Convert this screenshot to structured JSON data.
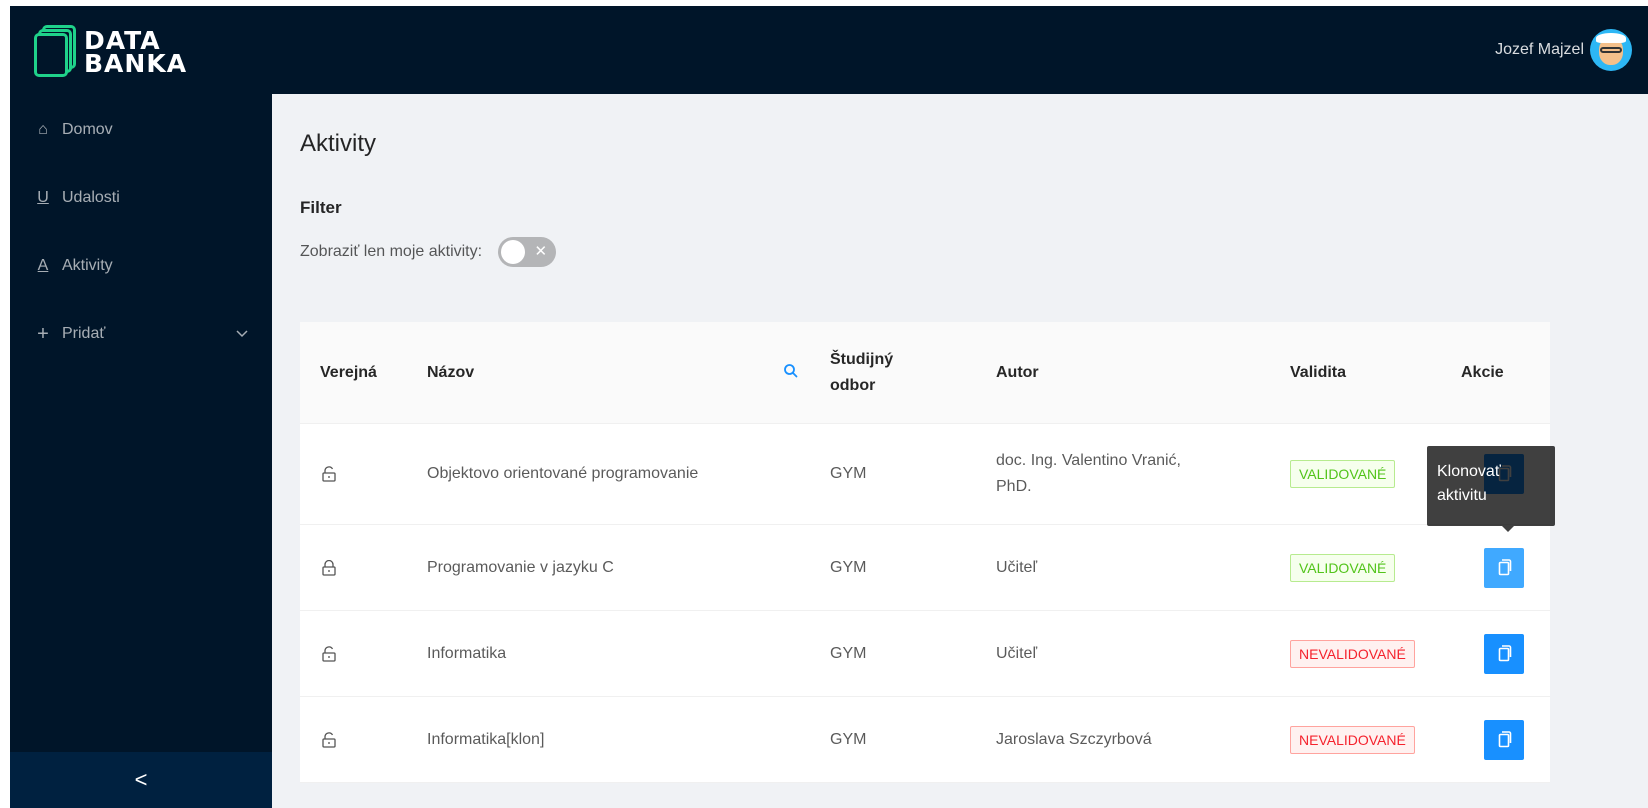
{
  "brand": {
    "line1": "DATA",
    "line2": "BANKA"
  },
  "user": {
    "name": "Jozef Majzel"
  },
  "sidebar": {
    "items": [
      {
        "label": "Domov",
        "icon": "home-icon",
        "glyph": "⌂"
      },
      {
        "label": "Udalosti",
        "icon": "u-letter-icon",
        "glyph": "U"
      },
      {
        "label": "Aktivity",
        "icon": "a-letter-icon",
        "glyph": "A"
      },
      {
        "label": "Pridať",
        "icon": "plus-icon",
        "glyph": "+"
      }
    ],
    "collapse_glyph": "<"
  },
  "page": {
    "title": "Aktivity",
    "filter_title": "Filter",
    "filter_label": "Zobraziť len moje aktivity:",
    "switch_on": false
  },
  "table": {
    "columns": {
      "public": "Verejná",
      "name": "Názov",
      "field_l1": "Študijný",
      "field_l2": "odbor",
      "author": "Autor",
      "validity": "Validita",
      "actions": "Akcie"
    },
    "rows": [
      {
        "name": "Objektovo orientované programovanie",
        "field": "GYM",
        "author_l1": "doc. Ing. Valentino Vranić,",
        "author_l2": "PhD.",
        "validity": "VALIDOVANÉ",
        "locked": false
      },
      {
        "name": "Programovanie v jazyku C",
        "field": "GYM",
        "author_l1": "Učiteľ",
        "author_l2": "",
        "validity": "VALIDOVANÉ",
        "locked": true
      },
      {
        "name": "Informatika",
        "field": "GYM",
        "author_l1": "Učiteľ",
        "author_l2": "",
        "validity": "NEVALIDOVANÉ",
        "locked": false
      },
      {
        "name": "Informatika[klon]",
        "field": "GYM",
        "author_l1": "Jaroslava Szczyrbová",
        "author_l2": "",
        "validity": "NEVALIDOVANÉ",
        "locked": false
      }
    ]
  },
  "tooltip": {
    "line1": "Klonovať",
    "line2": "aktivitu"
  },
  "colors": {
    "header": "#001529",
    "primary": "#1890ff",
    "logo_green": "#1fd28a",
    "valid": "#52c41a",
    "invalid": "#f5222d"
  }
}
